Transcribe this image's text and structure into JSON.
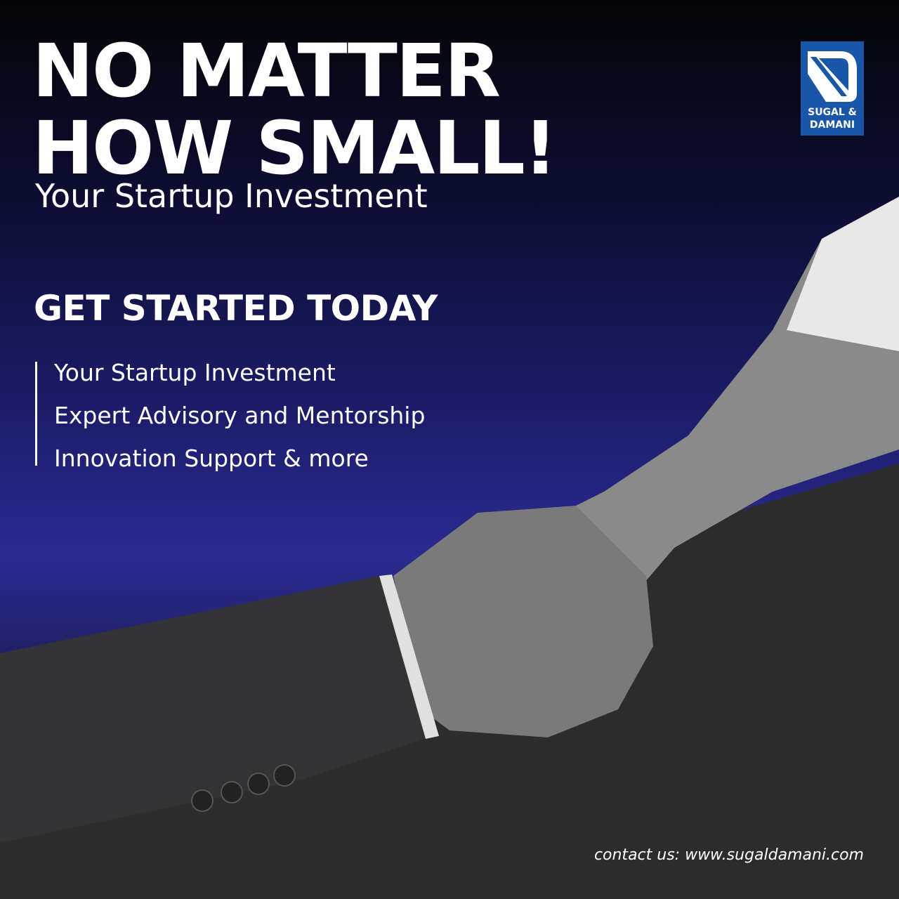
{
  "headline": {
    "line1": "NO MATTER",
    "line2": "HOW SMALL!"
  },
  "subtitle": "Your Startup Investment",
  "cta": "GET STARTED TODAY",
  "features": [
    "Your Startup Investment",
    "Expert Advisory and Mentorship",
    "Innovation Support & more"
  ],
  "logo": {
    "line1": "SUGAL &",
    "line2": "DAMANI",
    "color": "#1a56a8"
  },
  "contact": "contact us: www.sugaldamani.com"
}
